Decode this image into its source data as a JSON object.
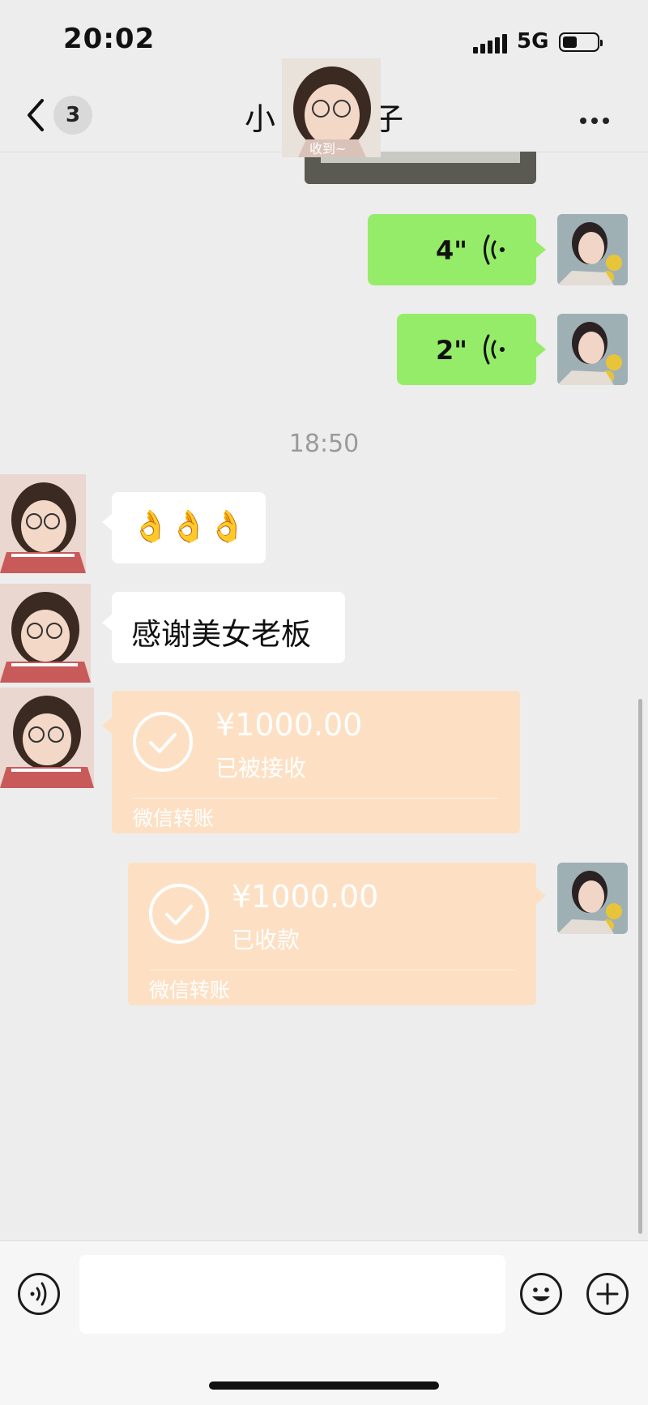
{
  "status_bar": {
    "time": "20:02",
    "network": "5G"
  },
  "header": {
    "back_badge": "3",
    "title_left": "小",
    "title_right": "子",
    "more_icon": "more-dots-icon"
  },
  "sticker": {
    "caption": "收到~"
  },
  "messages": {
    "voice1": {
      "duration": "4\""
    },
    "voice2": {
      "duration": "2\""
    },
    "time_divider": "18:50",
    "emoji_msg": "👌👌👌",
    "text_msg": "感谢美女老板",
    "transfer_in": {
      "amount": "¥1000.00",
      "status": "已被接收",
      "label": "微信转账"
    },
    "transfer_out": {
      "amount": "¥1000.00",
      "status": "已收款",
      "label": "微信转账"
    }
  },
  "input": {
    "placeholder": "",
    "value": ""
  },
  "colors": {
    "sent_bubble": "#95ec69",
    "transfer_card": "#fde0c4",
    "background": "#ededed"
  }
}
